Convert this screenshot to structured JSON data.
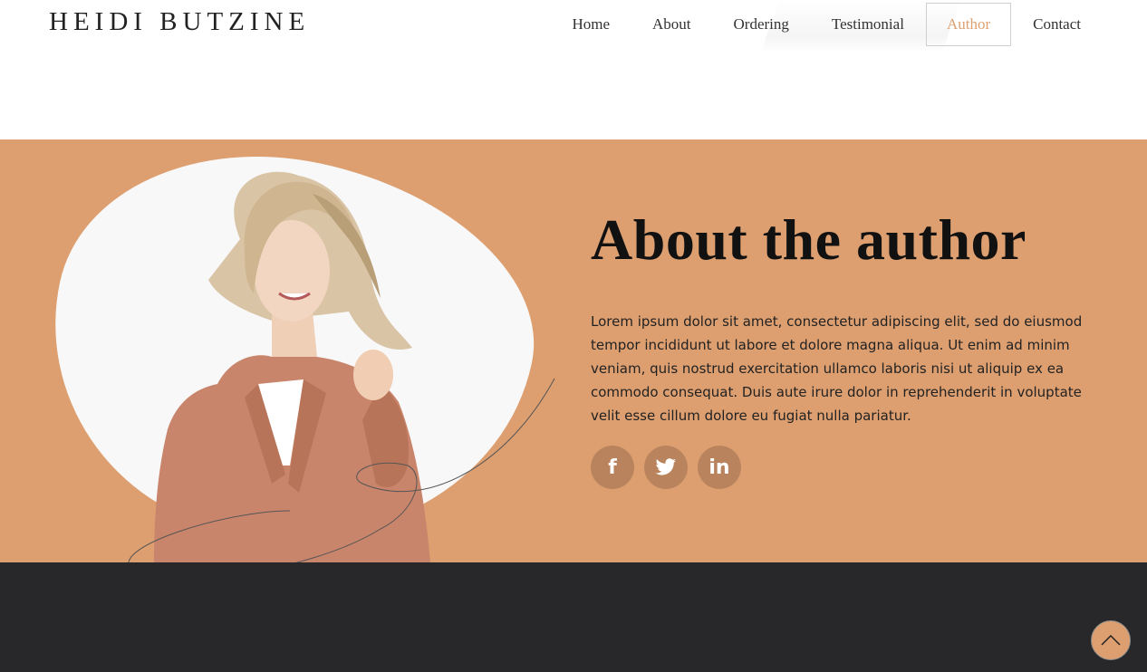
{
  "brand": {
    "logo": "HEIDI BUTZINE"
  },
  "nav": {
    "items": [
      {
        "label": "Home"
      },
      {
        "label": "About"
      },
      {
        "label": "Ordering"
      },
      {
        "label": "Testimonial"
      },
      {
        "label": "Author",
        "active": true
      },
      {
        "label": "Contact"
      }
    ]
  },
  "author": {
    "title": "About the author",
    "body": "Lorem ipsum dolor sit amet, consectetur adipiscing elit, sed do eiusmod tempor incididunt ut labore et dolore magna aliqua. Ut enim ad minim veniam, quis nostrud exercitation ullamco laboris nisi ut aliquip ex ea commodo consequat. Duis aute irure dolor in reprehenderit in voluptate velit esse cillum dolore eu fugiat nulla pariatur.",
    "socials": [
      {
        "icon": "facebook-icon",
        "glyph": "f"
      },
      {
        "icon": "twitter-icon",
        "glyph": "t"
      },
      {
        "icon": "linkedin-icon",
        "glyph": "in"
      }
    ]
  },
  "colors": {
    "accent": "#dd9f70",
    "social_bg": "#b9845d",
    "footer_bg": "#28282a"
  },
  "back_to_top": {
    "icon": "chevron-up-icon"
  }
}
